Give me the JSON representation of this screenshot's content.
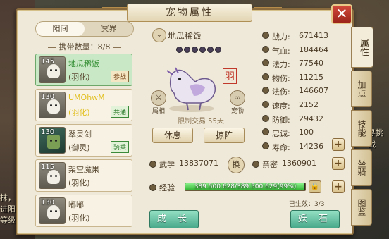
{
  "window": {
    "title": "宠物属性"
  },
  "background_text": [
    "抹，滴",
    "进阳",
    "等级份子",
    "寻挑战"
  ],
  "realm_tabs": [
    {
      "label": "阳间",
      "active": true
    },
    {
      "label": "冥界",
      "active": false
    }
  ],
  "carry": "携带数量：8/8",
  "pets": [
    {
      "level": "145",
      "name": "地瓜稀饭",
      "type": "(羽化)",
      "tag": "参战",
      "tag_style": "default",
      "selected": true,
      "avatar": "white-cat"
    },
    {
      "level": "130",
      "name": "UMOhwM",
      "type": "(羽化)",
      "tag": "共通",
      "tag_style": "green",
      "selected": false,
      "avatar": "white-cat"
    },
    {
      "level": "130",
      "name": "翠灵剑",
      "type": "(御灵)",
      "tag": "骑乘",
      "tag_style": "green",
      "selected": false,
      "avatar": "dragon"
    },
    {
      "level": "115",
      "name": "架空魔果",
      "type": "(羽化)",
      "tag": "",
      "tag_style": "default",
      "selected": false,
      "avatar": "white-cat"
    },
    {
      "level": "130",
      "name": "嘟嘟",
      "type": "(羽化)",
      "tag": "",
      "tag_style": "default",
      "selected": false,
      "avatar": "white-cat"
    }
  ],
  "pet_detail": {
    "name": "地瓜稀饭",
    "left_icon_label": "属相",
    "right_icon_label": "宠物",
    "stamp": "羽",
    "limit": "限制交易 55天",
    "rest_button": "休息",
    "formation_button": "掠阵",
    "wuxue_label": "武学",
    "wuxue_value": "13837071",
    "swap_icon": "换",
    "intimacy_label": "亲密",
    "intimacy_value": "1360901",
    "exp_label": "经验",
    "exp_text": "389.500.628/389.500.629(99%)",
    "exp_fill": 99,
    "effect": "已生效：3/3",
    "grow_button": "成 长",
    "stone_button": "妖 石"
  },
  "stats": [
    {
      "label": "战力:",
      "value": "671413",
      "icon": "power-icon"
    },
    {
      "label": "气血:",
      "value": "184464",
      "icon": "hp-icon"
    },
    {
      "label": "法力:",
      "value": "77540",
      "icon": "mana-icon"
    },
    {
      "label": "物伤:",
      "value": "11215",
      "icon": "physical-damage-icon"
    },
    {
      "label": "法伤:",
      "value": "146607",
      "icon": "magic-damage-icon"
    },
    {
      "label": "速度:",
      "value": "2152",
      "icon": "speed-icon"
    },
    {
      "label": "防御:",
      "value": "29432",
      "icon": "defense-icon"
    },
    {
      "label": "忠诚:",
      "value": "100",
      "icon": "loyalty-icon"
    },
    {
      "label": "寿命:",
      "value": "14236",
      "icon": "lifespan-icon"
    }
  ],
  "side_tabs": [
    {
      "label": "属性",
      "active": true
    },
    {
      "label": "加点",
      "active": false
    },
    {
      "label": "技能",
      "active": false
    },
    {
      "label": "坐骑",
      "active": false
    },
    {
      "label": "图鉴",
      "active": false
    }
  ],
  "colors": {
    "panel": "#efe9d9",
    "selected_row": "#c9e9c6",
    "accent_green": "#49a98a",
    "close_red": "#c0392b"
  }
}
